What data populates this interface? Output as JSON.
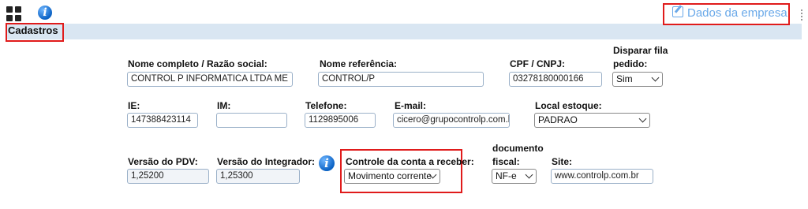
{
  "header": {
    "section_title": "Cadastros",
    "company_link": "Dados da empresa"
  },
  "form": {
    "nome_completo": {
      "label": "Nome completo / Razão social:",
      "value": "CONTROL P INFORMATICA LTDA ME"
    },
    "nome_referencia": {
      "label": "Nome referência:",
      "value": "CONTROL/P"
    },
    "cpf_cnpj": {
      "label": "CPF / CNPJ:",
      "value": "03278180000166"
    },
    "disparar": {
      "label_line1": "Disparar fila",
      "label_line2": "pedido:",
      "value": "Sim"
    },
    "ie": {
      "label": "IE:",
      "value": "147388423114"
    },
    "im": {
      "label": "IM:",
      "value": ""
    },
    "telefone": {
      "label": "Telefone:",
      "value": "1129895006"
    },
    "email": {
      "label": "E-mail:",
      "value": "cicero@grupocontrolp.com.br"
    },
    "local_estoque": {
      "label": "Local estoque:",
      "value": "PADRAO"
    },
    "versao_pdv": {
      "label": "Versão do PDV:",
      "value": "1,25200"
    },
    "versao_integrador": {
      "label": "Versão do Integrador:",
      "value": "1,25300"
    },
    "controle_conta": {
      "label": "Controle da conta a receber:",
      "value": "Movimento corrente"
    },
    "documento_fiscal": {
      "label_line1": "documento",
      "label_line2": "fiscal:",
      "value": "NF-e"
    },
    "site": {
      "label": "Site:",
      "value": "www.controlp.com.br"
    }
  },
  "icons": {
    "apps": "grid-icon",
    "info": "info-icon",
    "edit": "edit-icon",
    "more": "vertical-dots-icon"
  },
  "colors": {
    "header_bar": "#d9e6f2",
    "highlight": "#e01b1b",
    "link": "#6aa9e9",
    "info": "#0b62c4"
  }
}
